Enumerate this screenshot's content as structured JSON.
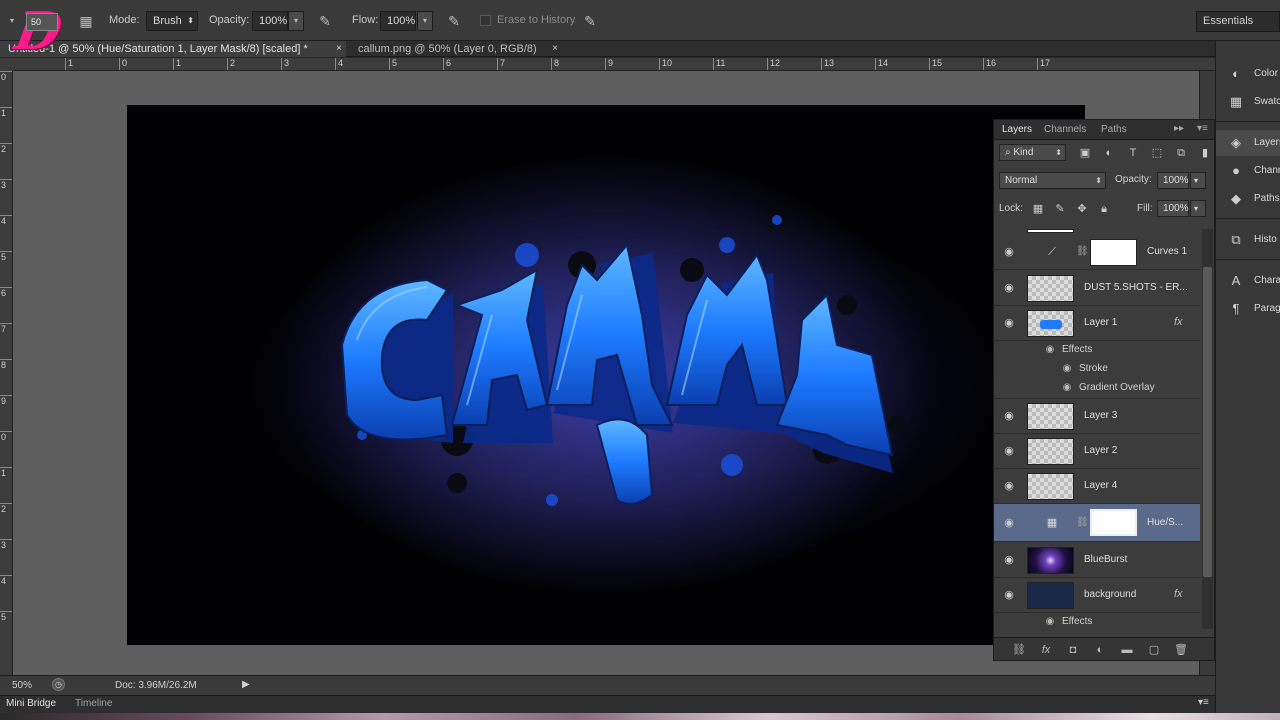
{
  "options_bar": {
    "brush_size": "50",
    "mode_label": "Mode:",
    "mode_value": "Brush",
    "opacity_label": "Opacity:",
    "opacity_value": "100%",
    "flow_label": "Flow:",
    "flow_value": "100%",
    "erase_history_label": "Erase to History",
    "workspace": "Essentials"
  },
  "tabs": [
    {
      "label": "Untitled-1 @ 50% (Hue/Saturation 1, Layer Mask/8) [scaled] *",
      "close": "×"
    },
    {
      "label": "callum.png @ 50% (Layer 0, RGB/8)",
      "close": "×"
    }
  ],
  "rulers": {
    "h": [
      "1",
      "0",
      "1",
      "2",
      "3",
      "4",
      "5",
      "6",
      "7",
      "8",
      "9",
      "10",
      "11",
      "12",
      "13",
      "14",
      "15",
      "16",
      "17"
    ],
    "v": [
      "0",
      "1",
      "2",
      "3",
      "4",
      "5",
      "6",
      "7",
      "8",
      "9",
      "0",
      "1",
      "2",
      "3",
      "4",
      "5"
    ]
  },
  "status": {
    "zoom": "50%",
    "doc": "Doc: 3.96M/26.2M"
  },
  "bottom_panels": {
    "mini_bridge": "Mini Bridge",
    "timeline": "Timeline"
  },
  "dock": [
    {
      "label": "Color",
      "icon": "color-icon"
    },
    {
      "label": "Swatc",
      "icon": "swatches-icon"
    },
    {
      "label": "Layers",
      "icon": "layers-icon"
    },
    {
      "label": "Chann",
      "icon": "channels-icon"
    },
    {
      "label": "Paths",
      "icon": "paths-icon"
    },
    {
      "label": "Histo",
      "icon": "history-icon"
    },
    {
      "label": "Chara",
      "icon": "character-icon"
    },
    {
      "label": "Parag",
      "icon": "paragraph-icon"
    }
  ],
  "layers_panel": {
    "tabs": [
      "Layers",
      "Channels",
      "Paths"
    ],
    "filter_kind": "Kind",
    "blend_mode": "Normal",
    "opacity_label": "Opacity:",
    "opacity_value": "100%",
    "lock_label": "Lock:",
    "fill_label": "Fill:",
    "fill_value": "100%",
    "layers": [
      {
        "name": "Curves 1"
      },
      {
        "name": "DUST 5.SHOTS - ER..."
      },
      {
        "name": "Layer 1",
        "fx": "fx"
      },
      {
        "name": "Layer 3"
      },
      {
        "name": "Layer 2"
      },
      {
        "name": "Layer 4"
      },
      {
        "name": "Hue/S...",
        "selected": true
      },
      {
        "name": "BlueBurst"
      },
      {
        "name": "background",
        "fx": "fx"
      }
    ],
    "effects": {
      "group_label": "Effects",
      "stroke": "Stroke",
      "gradient_overlay": "Gradient Overlay",
      "bg_group_label": "Effects"
    }
  },
  "artwork": {
    "word": "CALLUM",
    "accent_color": "#1e7bff"
  },
  "colors": {
    "selected_layer": "#5a6a8a",
    "logo_pink": "#ff1a8c"
  }
}
